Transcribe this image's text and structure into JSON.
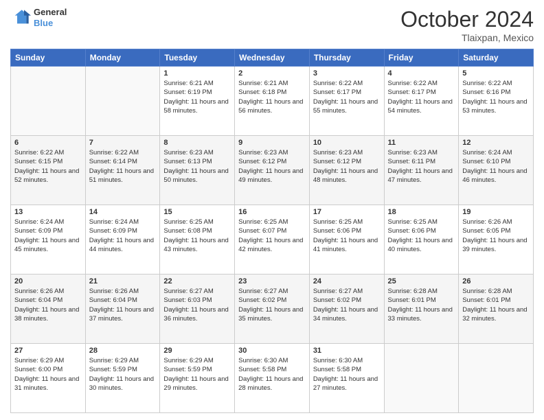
{
  "header": {
    "logo_line1": "General",
    "logo_line2": "Blue",
    "month": "October 2024",
    "location": "Tlaixpan, Mexico"
  },
  "days_of_week": [
    "Sunday",
    "Monday",
    "Tuesday",
    "Wednesday",
    "Thursday",
    "Friday",
    "Saturday"
  ],
  "weeks": [
    [
      {
        "day": "",
        "info": ""
      },
      {
        "day": "",
        "info": ""
      },
      {
        "day": "1",
        "info": "Sunrise: 6:21 AM\nSunset: 6:19 PM\nDaylight: 11 hours and 58 minutes."
      },
      {
        "day": "2",
        "info": "Sunrise: 6:21 AM\nSunset: 6:18 PM\nDaylight: 11 hours and 56 minutes."
      },
      {
        "day": "3",
        "info": "Sunrise: 6:22 AM\nSunset: 6:17 PM\nDaylight: 11 hours and 55 minutes."
      },
      {
        "day": "4",
        "info": "Sunrise: 6:22 AM\nSunset: 6:17 PM\nDaylight: 11 hours and 54 minutes."
      },
      {
        "day": "5",
        "info": "Sunrise: 6:22 AM\nSunset: 6:16 PM\nDaylight: 11 hours and 53 minutes."
      }
    ],
    [
      {
        "day": "6",
        "info": "Sunrise: 6:22 AM\nSunset: 6:15 PM\nDaylight: 11 hours and 52 minutes."
      },
      {
        "day": "7",
        "info": "Sunrise: 6:22 AM\nSunset: 6:14 PM\nDaylight: 11 hours and 51 minutes."
      },
      {
        "day": "8",
        "info": "Sunrise: 6:23 AM\nSunset: 6:13 PM\nDaylight: 11 hours and 50 minutes."
      },
      {
        "day": "9",
        "info": "Sunrise: 6:23 AM\nSunset: 6:12 PM\nDaylight: 11 hours and 49 minutes."
      },
      {
        "day": "10",
        "info": "Sunrise: 6:23 AM\nSunset: 6:12 PM\nDaylight: 11 hours and 48 minutes."
      },
      {
        "day": "11",
        "info": "Sunrise: 6:23 AM\nSunset: 6:11 PM\nDaylight: 11 hours and 47 minutes."
      },
      {
        "day": "12",
        "info": "Sunrise: 6:24 AM\nSunset: 6:10 PM\nDaylight: 11 hours and 46 minutes."
      }
    ],
    [
      {
        "day": "13",
        "info": "Sunrise: 6:24 AM\nSunset: 6:09 PM\nDaylight: 11 hours and 45 minutes."
      },
      {
        "day": "14",
        "info": "Sunrise: 6:24 AM\nSunset: 6:09 PM\nDaylight: 11 hours and 44 minutes."
      },
      {
        "day": "15",
        "info": "Sunrise: 6:25 AM\nSunset: 6:08 PM\nDaylight: 11 hours and 43 minutes."
      },
      {
        "day": "16",
        "info": "Sunrise: 6:25 AM\nSunset: 6:07 PM\nDaylight: 11 hours and 42 minutes."
      },
      {
        "day": "17",
        "info": "Sunrise: 6:25 AM\nSunset: 6:06 PM\nDaylight: 11 hours and 41 minutes."
      },
      {
        "day": "18",
        "info": "Sunrise: 6:25 AM\nSunset: 6:06 PM\nDaylight: 11 hours and 40 minutes."
      },
      {
        "day": "19",
        "info": "Sunrise: 6:26 AM\nSunset: 6:05 PM\nDaylight: 11 hours and 39 minutes."
      }
    ],
    [
      {
        "day": "20",
        "info": "Sunrise: 6:26 AM\nSunset: 6:04 PM\nDaylight: 11 hours and 38 minutes."
      },
      {
        "day": "21",
        "info": "Sunrise: 6:26 AM\nSunset: 6:04 PM\nDaylight: 11 hours and 37 minutes."
      },
      {
        "day": "22",
        "info": "Sunrise: 6:27 AM\nSunset: 6:03 PM\nDaylight: 11 hours and 36 minutes."
      },
      {
        "day": "23",
        "info": "Sunrise: 6:27 AM\nSunset: 6:02 PM\nDaylight: 11 hours and 35 minutes."
      },
      {
        "day": "24",
        "info": "Sunrise: 6:27 AM\nSunset: 6:02 PM\nDaylight: 11 hours and 34 minutes."
      },
      {
        "day": "25",
        "info": "Sunrise: 6:28 AM\nSunset: 6:01 PM\nDaylight: 11 hours and 33 minutes."
      },
      {
        "day": "26",
        "info": "Sunrise: 6:28 AM\nSunset: 6:01 PM\nDaylight: 11 hours and 32 minutes."
      }
    ],
    [
      {
        "day": "27",
        "info": "Sunrise: 6:29 AM\nSunset: 6:00 PM\nDaylight: 11 hours and 31 minutes."
      },
      {
        "day": "28",
        "info": "Sunrise: 6:29 AM\nSunset: 5:59 PM\nDaylight: 11 hours and 30 minutes."
      },
      {
        "day": "29",
        "info": "Sunrise: 6:29 AM\nSunset: 5:59 PM\nDaylight: 11 hours and 29 minutes."
      },
      {
        "day": "30",
        "info": "Sunrise: 6:30 AM\nSunset: 5:58 PM\nDaylight: 11 hours and 28 minutes."
      },
      {
        "day": "31",
        "info": "Sunrise: 6:30 AM\nSunset: 5:58 PM\nDaylight: 11 hours and 27 minutes."
      },
      {
        "day": "",
        "info": ""
      },
      {
        "day": "",
        "info": ""
      }
    ]
  ]
}
